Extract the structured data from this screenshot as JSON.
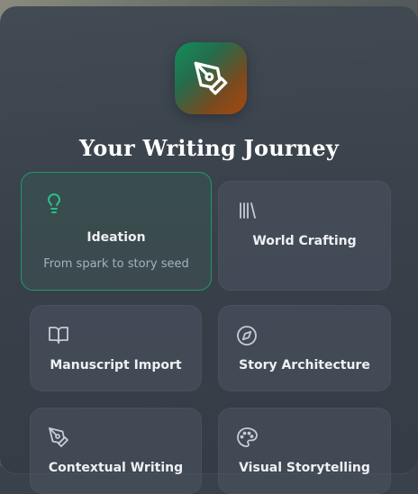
{
  "title": "Your Writing Journey",
  "cards": [
    {
      "label": "Ideation",
      "subtitle": "From spark to story seed",
      "icon": "lightbulb-icon",
      "active": true
    },
    {
      "label": "World Crafting",
      "icon": "library-icon",
      "active": false
    },
    {
      "label": "Manuscript Import",
      "icon": "book-open-icon",
      "active": false
    },
    {
      "label": "Story Architecture",
      "icon": "compass-icon",
      "active": false
    },
    {
      "label": "Contextual Writing",
      "icon": "pen-tool-icon",
      "active": false
    },
    {
      "label": "Visual Storytelling",
      "icon": "palette-icon",
      "active": false
    }
  ],
  "colors": {
    "accent": "#1f9b6a",
    "logo_start": "#0f8f5a",
    "logo_end": "#a7480f"
  }
}
